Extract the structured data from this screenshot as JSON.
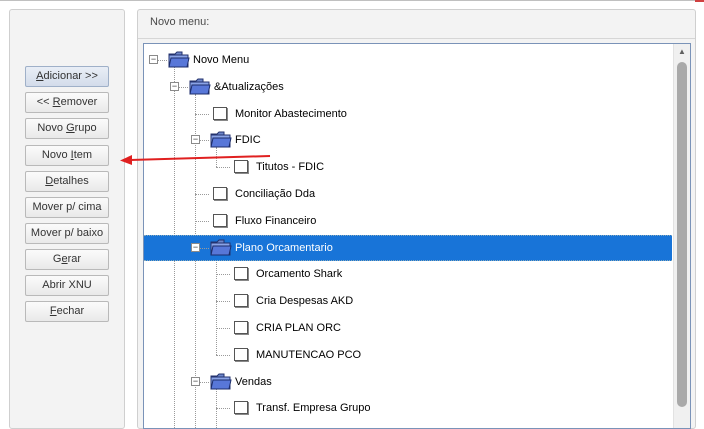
{
  "window": {
    "accent_color": "#1874d8",
    "selection_color": "#1874d8"
  },
  "buttons": [
    {
      "label": "Adicionar >>",
      "underline": "A"
    },
    {
      "label": "<< Remover",
      "underline": "R"
    },
    {
      "label": "Novo Grupo",
      "underline": "G"
    },
    {
      "label": "Novo Item",
      "underline": "I"
    },
    {
      "label": "Detalhes",
      "underline": "D"
    },
    {
      "label": "Mover p/ cima",
      "underline": ""
    },
    {
      "label": "Mover p/ baixo",
      "underline": ""
    },
    {
      "label": "Gerar",
      "underline": "e"
    },
    {
      "label": "Abrir XNU",
      "underline": ""
    },
    {
      "label": "Fechar",
      "underline": "F"
    }
  ],
  "menu_panel": {
    "title": "Novo menu:"
  },
  "tree": {
    "items": [
      {
        "label": "Novo Menu",
        "type": "folder",
        "expanded": true,
        "level": 0
      },
      {
        "label": "&Atualizações",
        "type": "folder",
        "expanded": true,
        "level": 1
      },
      {
        "label": "Monitor Abastecimento",
        "type": "item",
        "level": 2
      },
      {
        "label": "FDIC",
        "type": "folder",
        "expanded": true,
        "level": 2
      },
      {
        "label": "Titutos - FDIC",
        "type": "item",
        "level": 3
      },
      {
        "label": "Conciliação Dda",
        "type": "item",
        "level": 2
      },
      {
        "label": "Fluxo Financeiro",
        "type": "item",
        "level": 2
      },
      {
        "label": "Plano Orcamentario",
        "type": "folder",
        "expanded": true,
        "level": 2,
        "selected": true
      },
      {
        "label": "Orcamento Shark",
        "type": "item",
        "level": 3
      },
      {
        "label": "Cria Despesas AKD",
        "type": "item",
        "level": 3
      },
      {
        "label": "CRIA PLAN ORC",
        "type": "item",
        "level": 3
      },
      {
        "label": "MANUTENCAO PCO",
        "type": "item",
        "level": 3
      },
      {
        "label": "Vendas",
        "type": "folder",
        "expanded": true,
        "level": 2
      },
      {
        "label": "Transf. Empresa Grupo",
        "type": "item",
        "level": 3
      }
    ]
  },
  "annotation": {
    "arrow_color": "#e02020",
    "points_to": "Novo Item"
  }
}
